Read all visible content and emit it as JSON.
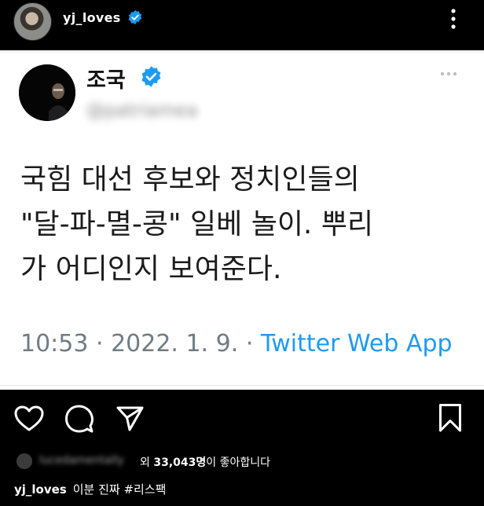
{
  "post": {
    "username": "yj_loves",
    "verified": true,
    "more_icon": "more-vertical-icon"
  },
  "tweet": {
    "name": "조국",
    "handle": "@patriamea",
    "body_lines": [
      "국힘 대선 후보와 정치인들의",
      "\"달-파-멸-콩\" 일베 놀이. 뿌리",
      "가 어디인지 보여준다."
    ],
    "time": "10:53",
    "date": "2022. 1. 9.",
    "source": "Twitter Web App",
    "sep": " · "
  },
  "actions": {
    "like_icon": "heart-icon",
    "comment_icon": "comment-icon",
    "share_icon": "send-icon",
    "save_icon": "bookmark-icon"
  },
  "likes": {
    "liker_name": "lucedamentally",
    "connector": "외",
    "count": "33,043명",
    "suffix": "이 좋아합니다"
  },
  "caption": {
    "username": "yj_loves",
    "text": "이분 진짜 #리스팩"
  },
  "colors": {
    "verified_blue": "#1d9bf0",
    "link_blue": "#1d9bf0",
    "meta_gray": "#6f7c86",
    "bg": "#000000"
  }
}
